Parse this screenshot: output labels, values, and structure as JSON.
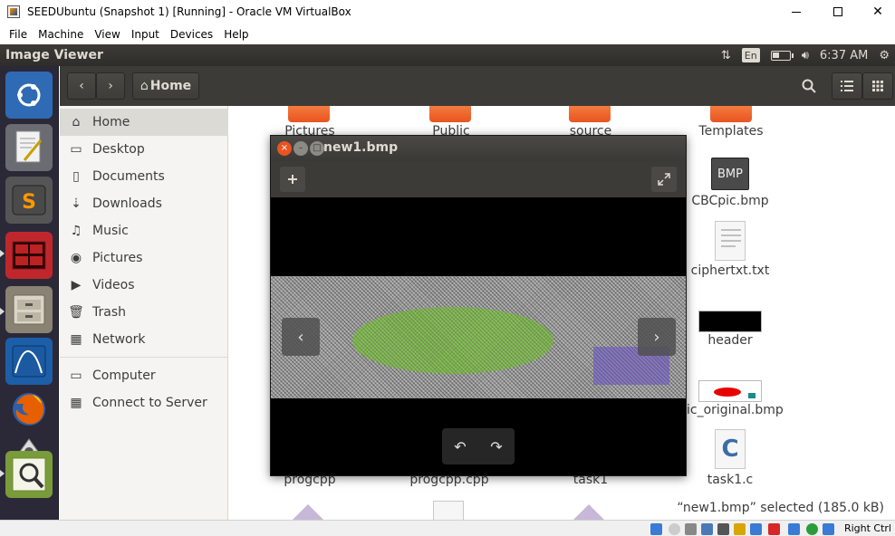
{
  "host": {
    "title": "SEEDUbuntu (Snapshot 1) [Running] - Oracle VM VirtualBox",
    "menu": [
      "File",
      "Machine",
      "View",
      "Input",
      "Devices",
      "Help"
    ],
    "status_right_ctrl": "Right Ctrl"
  },
  "panel": {
    "app_name": "Image Viewer",
    "keyboard": "En",
    "time": "6:37 AM"
  },
  "toolbar": {
    "home_label": "Home"
  },
  "sidebar": {
    "items": [
      {
        "label": "Home",
        "icon": "home-icon"
      },
      {
        "label": "Desktop",
        "icon": "desktop-icon"
      },
      {
        "label": "Documents",
        "icon": "documents-icon"
      },
      {
        "label": "Downloads",
        "icon": "downloads-icon"
      },
      {
        "label": "Music",
        "icon": "music-icon"
      },
      {
        "label": "Pictures",
        "icon": "pictures-icon"
      },
      {
        "label": "Videos",
        "icon": "videos-icon"
      },
      {
        "label": "Trash",
        "icon": "trash-icon"
      },
      {
        "label": "Network",
        "icon": "network-icon"
      },
      {
        "label": "Computer",
        "icon": "computer-icon"
      },
      {
        "label": "Connect to Server",
        "icon": "server-icon"
      }
    ]
  },
  "files": {
    "row1": [
      "Pictures",
      "Public",
      "source",
      "Templates"
    ],
    "right_column": [
      "CBCpic.bmp",
      "ciphertxt.txt",
      "header",
      "ic_original.bmp",
      "task1.c"
    ],
    "bmp_badge": "BMP",
    "row_bottom": [
      "progcpp",
      "progcpp.cpp",
      "task1"
    ],
    "status": "“new1.bmp” selected  (185.0 kB)"
  },
  "viewer": {
    "title": "new1.bmp"
  },
  "colors": {
    "ubuntu_orange": "#e95420",
    "panel_dark": "#3c3b37",
    "launcher_bg": "#2b2938",
    "window_close": "#e95420"
  }
}
